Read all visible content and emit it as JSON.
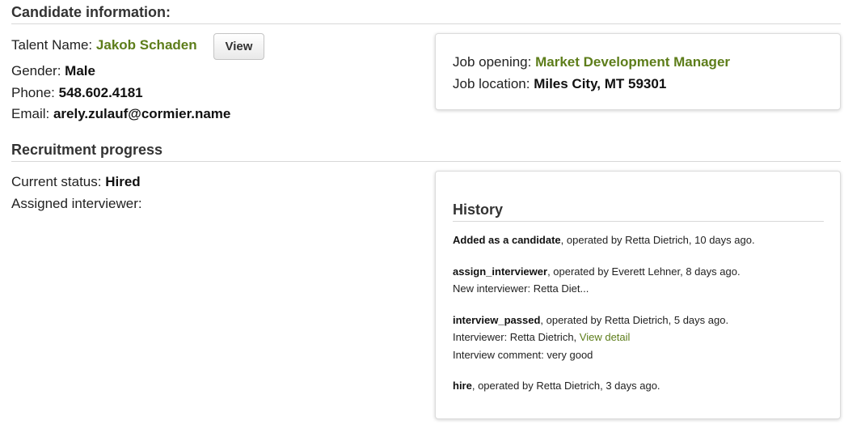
{
  "candidate": {
    "section_title": "Candidate information:",
    "talent_label": "Talent Name:",
    "talent_name": "Jakob Schaden",
    "view_button": "View",
    "gender_label": "Gender:",
    "gender": "Male",
    "phone_label": "Phone:",
    "phone": "548.602.4181",
    "email_label": "Email:",
    "email": "arely.zulauf@cormier.name"
  },
  "job": {
    "opening_label": "Job opening:",
    "opening": "Market Development Manager",
    "location_label": "Job location:",
    "location": "Miles City, MT 59301"
  },
  "progress": {
    "section_title": "Recruitment progress",
    "status_label": "Current status:",
    "status": "Hired",
    "interviewer_label": "Assigned interviewer:"
  },
  "history": {
    "title": "History",
    "entries": [
      {
        "action": "Added as a candidate",
        "meta": ", operated by Retta Dietrich, 10 days ago."
      },
      {
        "action": "assign_interviewer",
        "meta": ", operated by Everett Lehner, 8 days ago.",
        "detail": "New interviewer: Retta Diet..."
      },
      {
        "action": "interview_passed",
        "meta": ", operated by Retta Dietrich, 5 days ago.",
        "detail_prefix": "Interviewer: Retta Dietrich, ",
        "link": "View detail",
        "comment": "Interview comment: very good"
      },
      {
        "action": "hire",
        "meta": ", operated by Retta Dietrich, 3 days ago."
      }
    ]
  },
  "colors": {
    "accent_green": "#5d7d1a"
  }
}
